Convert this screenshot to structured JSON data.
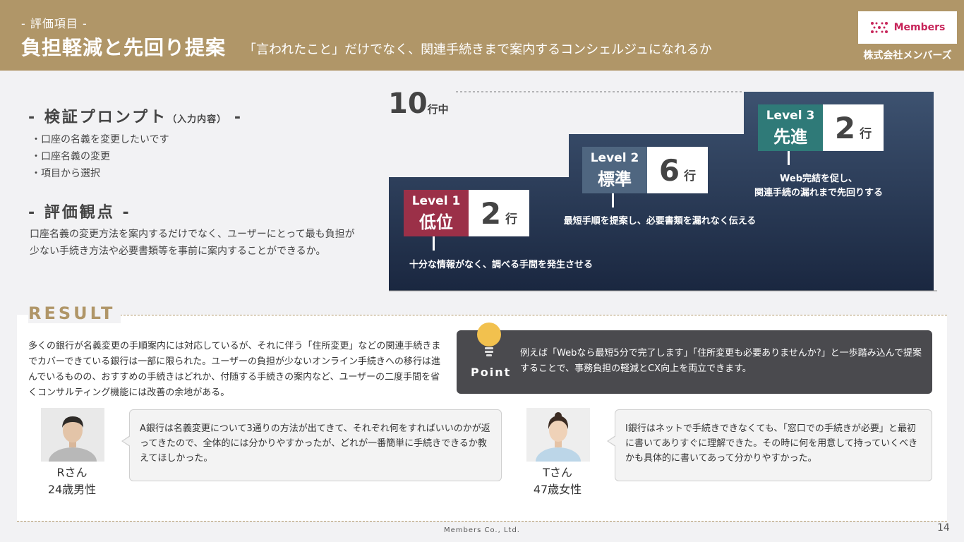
{
  "header": {
    "kicker": "- 評価項目 -",
    "title": "負担軽減と先回り提案",
    "subtitle": "「言われたこと」だけでなく、関連手続きまで案内するコンシェルジュになれるか",
    "logo_text": "Members",
    "company": "株式会社メンバーズ"
  },
  "prompt": {
    "heading": "- 検証プロンプト",
    "heading_small": "（入力内容）",
    "heading_end": " -",
    "items": [
      "・口座の名義を変更したいです",
      "・口座名義の変更",
      "・項目から選択"
    ]
  },
  "evaluation": {
    "heading": "- 評価観点 -",
    "text": "口座名義の変更方法を案内するだけでなく、ユーザーにとって最も負担が少ない手続き方法や必要書類等を事前に案内することができるか。"
  },
  "chart": {
    "total": "10",
    "total_unit": "行中",
    "levels": [
      {
        "level": "Level 1",
        "name": "低位",
        "count": "2",
        "unit": "行",
        "desc": "十分な情報がなく、調べる手間を発生させる",
        "color": "#9b3048"
      },
      {
        "level": "Level 2",
        "name": "標準",
        "count": "6",
        "unit": "行",
        "desc": "最短手順を提案し、必要書類を漏れなく伝える",
        "color": "#4f6680"
      },
      {
        "level": "Level 3",
        "name": "先進",
        "count": "2",
        "unit": "行",
        "desc": "Web完結を促し、\n関連手続の漏れまで先回りする",
        "color": "#2f7a78"
      }
    ]
  },
  "result": {
    "title": "RESULT",
    "text": "多くの銀行が名義変更の手順案内には対応しているが、それに伴う「住所変更」などの関連手続きまでカバーできている銀行は一部に限られた。ユーザーの負担が少ないオンライン手続きへの移行は進んでいるものの、おすすめの手続きはどれか、付随する手続きの案内など、ユーザーの二度手間を省くコンサルティング機能には改善の余地がある。",
    "point_label": "Point",
    "point_text": "例えば「Webなら最短5分で完了します」「住所変更も必要ありませんか?」と一歩踏み込んで提案することで、事務負担の軽減とCX向上を両立できます。"
  },
  "voices": [
    {
      "name": "Rさん",
      "profile": "24歳男性",
      "comment": "A銀行は名義変更について3通りの方法が出てきて、それぞれ何をすればいいのかが返ってきたので、全体的には分かりやすかったが、どれが一番簡単に手続きできるか教えてほしかった。"
    },
    {
      "name": "Tさん",
      "profile": "47歳女性",
      "comment": "I銀行はネットで手続きできなくても、「窓口での手続きが必要」と最初に書いてありすぐに理解できた。その時に何を用意して持っていくべきかも具体的に書いてあって分かりやすかった。"
    }
  ],
  "footer": {
    "company": "Members Co., Ltd.",
    "page": "14"
  },
  "icons": {
    "logo": "members-logo-icon",
    "bulb": "lightbulb-icon"
  },
  "colors": {
    "header": "#b09668",
    "accent": "#b09668",
    "point_bg": "#4a4a4e",
    "chart_bg_top": "#3d5270",
    "chart_bg_bottom": "#1a2740"
  }
}
